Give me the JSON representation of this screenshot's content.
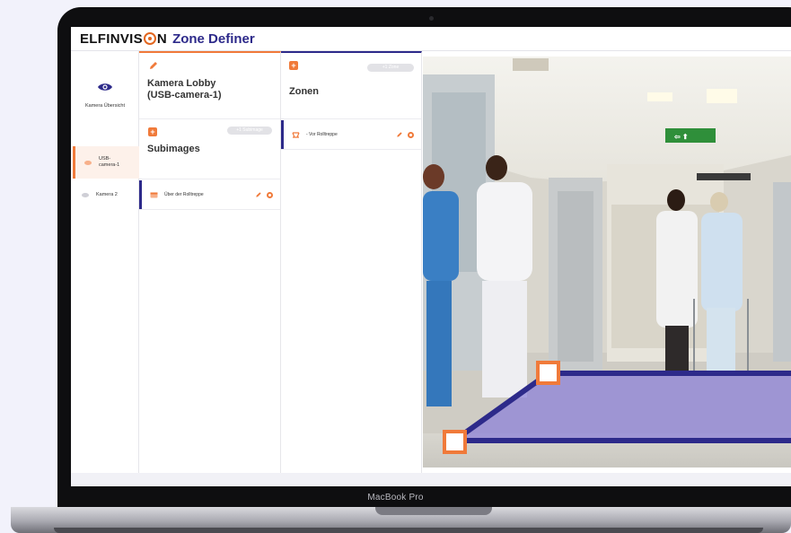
{
  "device": {
    "model_label": "MacBook Pro"
  },
  "header": {
    "brand_prefix": "ELFINVIS",
    "brand_suffix": "N",
    "title": "Zone Definer"
  },
  "nav": {
    "overview_label": "Kamera Übersicht",
    "cameras": [
      {
        "label": "USB-camera-1",
        "active": true
      },
      {
        "label": "Kamera 2",
        "active": false
      }
    ]
  },
  "camera_panel": {
    "name_line1": "Kamera Lobby",
    "name_line2": "(USB-camera-1)",
    "subimages_heading": "Subimages",
    "subimages_badge": "+1 Subimage",
    "subimages": [
      {
        "label": "Über der Rolltreppe"
      }
    ]
  },
  "zones_panel": {
    "heading": "Zonen",
    "badge": "+1 Zone",
    "zones": [
      {
        "label": "- Vor Rolltreppe"
      }
    ]
  },
  "colors": {
    "accent": "#f07a3a",
    "brand_blue": "#2d2a8a",
    "zone_fill": "#8a7fd8"
  },
  "icons": [
    "eye-icon",
    "pencil-icon",
    "plus-icon",
    "gear-icon",
    "zone-icon",
    "subimage-icon",
    "exit-sign-icon"
  ]
}
